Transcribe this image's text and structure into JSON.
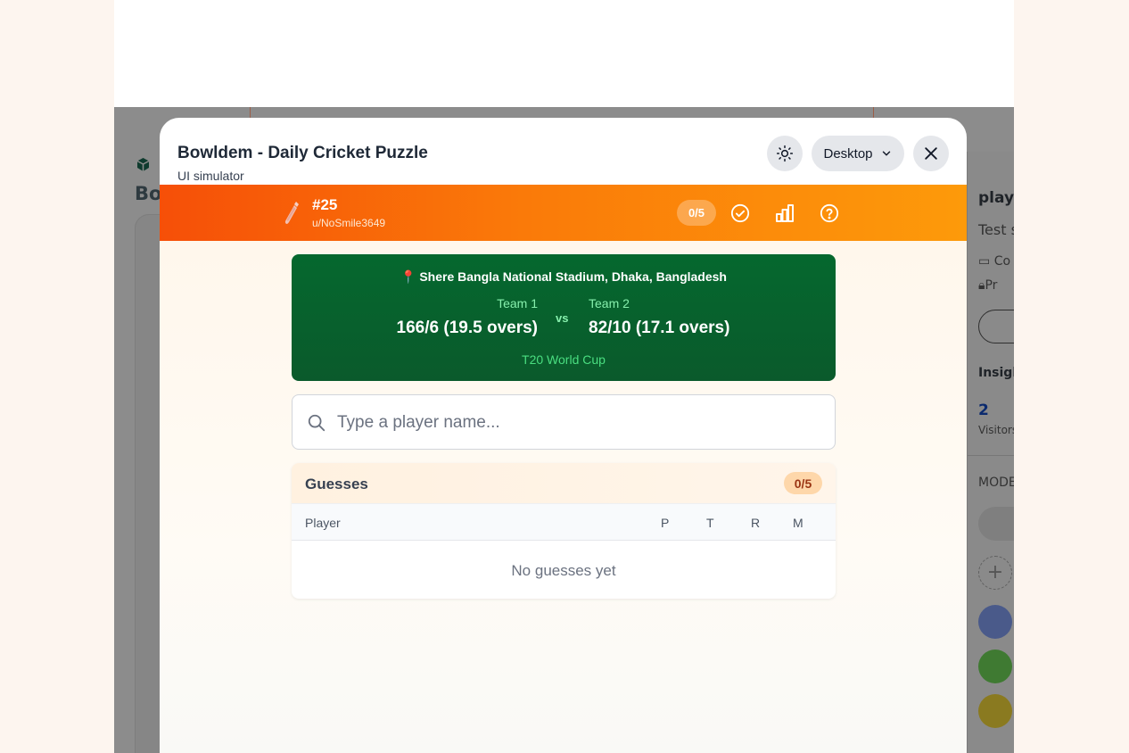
{
  "modal": {
    "title": "Bowldem - Daily Cricket Puzzle",
    "subtitle": "UI simulator",
    "device_label": "Desktop"
  },
  "game": {
    "puzzle_number": "#25",
    "user": "u/NoSmile3649",
    "guess_counter": "0/5",
    "accent": "#f97316"
  },
  "match": {
    "venue": "📍 Shere Bangla National Stadium, Dhaka, Bangladesh",
    "team1_label": "Team 1",
    "team1_score": "166/6 (19.5 overs)",
    "vs": "vs",
    "team2_label": "Team 2",
    "team2_score": "82/10 (17.1 overs)",
    "tournament": "T20 World Cup",
    "card_color": "#0a5f2e"
  },
  "search": {
    "placeholder": "Type a player name..."
  },
  "guesses": {
    "title": "Guesses",
    "count": "0/5",
    "columns": [
      "Player",
      "P",
      "T",
      "R",
      "M"
    ],
    "empty_text": "No guesses yet"
  },
  "background": {
    "left_text": "Bo",
    "right_title": "playb",
    "right_sub": "Test s",
    "right_row1": "Co",
    "right_row2": "Pr",
    "insights": "Insigh",
    "visitors_count": "2",
    "visitors_label": "Visitors",
    "mod_label": "MODE",
    "plus": "+"
  }
}
